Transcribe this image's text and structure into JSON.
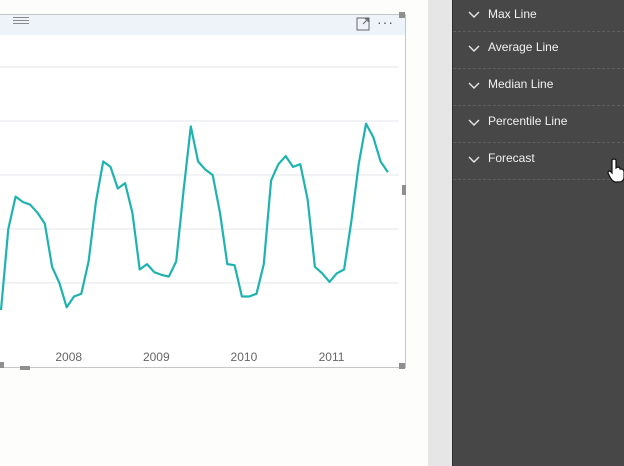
{
  "visual": {
    "header": {
      "drag_icon": "drag-lines-icon",
      "focus_icon": "focus-mode-icon",
      "more_icon": "more-options-icon",
      "more_glyph": "···"
    },
    "line_color": "#1fb3b0"
  },
  "chart_data": {
    "type": "line",
    "x_ticks": [
      "2008",
      "2009",
      "2010",
      "2011"
    ],
    "x": [
      "2007-04",
      "2007-05",
      "2007-06",
      "2007-07",
      "2007-08",
      "2007-09",
      "2007-10",
      "2007-11",
      "2007-12",
      "2008-01",
      "2008-02",
      "2008-03",
      "2008-04",
      "2008-05",
      "2008-06",
      "2008-07",
      "2008-08",
      "2008-09",
      "2008-10",
      "2008-11",
      "2008-12",
      "2009-01",
      "2009-02",
      "2009-03",
      "2009-04",
      "2009-05",
      "2009-06",
      "2009-07",
      "2009-08",
      "2009-09",
      "2009-10",
      "2009-11",
      "2009-12",
      "2010-01",
      "2010-02",
      "2010-03",
      "2010-04",
      "2010-05",
      "2010-06",
      "2010-07",
      "2010-08",
      "2010-09",
      "2010-10",
      "2010-11",
      "2010-12",
      "2011-01",
      "2011-02",
      "2011-03",
      "2011-04",
      "2011-05",
      "2011-06",
      "2011-07",
      "2011-08",
      "2011-09",
      "2011-10",
      "2011-11",
      "2011-12"
    ],
    "values": [
      0.5,
      2.0,
      2.6,
      2.5,
      2.45,
      2.3,
      2.1,
      1.3,
      1.0,
      0.55,
      0.75,
      0.8,
      1.4,
      2.5,
      3.25,
      3.15,
      2.75,
      2.85,
      2.3,
      1.25,
      1.35,
      1.2,
      1.15,
      1.12,
      1.4,
      2.7,
      3.9,
      3.25,
      3.1,
      3.0,
      2.3,
      1.35,
      1.33,
      0.75,
      0.75,
      0.8,
      1.35,
      2.9,
      3.2,
      3.35,
      3.15,
      3.2,
      2.55,
      1.3,
      1.18,
      1.02,
      1.18,
      1.25,
      2.15,
      3.2,
      3.95,
      3.7,
      3.25,
      3.05
    ],
    "grid": true,
    "legend": "none"
  },
  "pane": {
    "items": [
      {
        "label": "Max Line",
        "icon": "chevron-down-icon"
      },
      {
        "label": "Average Line",
        "icon": "chevron-down-icon"
      },
      {
        "label": "Median Line",
        "icon": "chevron-down-icon"
      },
      {
        "label": "Percentile Line",
        "icon": "chevron-down-icon"
      },
      {
        "label": "Forecast",
        "icon": "chevron-down-icon"
      }
    ]
  }
}
